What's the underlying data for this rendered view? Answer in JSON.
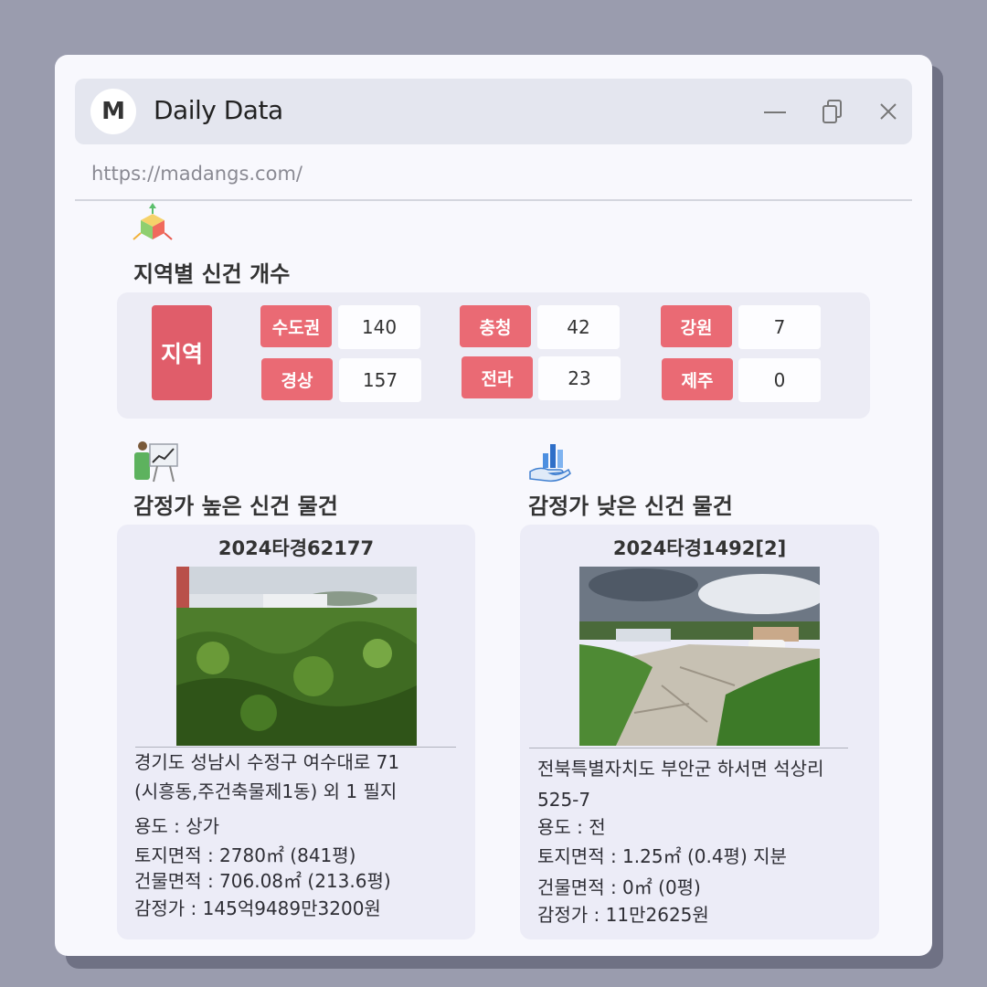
{
  "window": {
    "logo_letter": "M",
    "title": "Daily Data",
    "url": "https://madangs.com/"
  },
  "icons": {
    "region_section": "cube-axes-icon",
    "high_section": "presenter-chart-icon",
    "low_section": "hand-bar-chart-icon"
  },
  "regions": {
    "title": "지역별 신건 개수",
    "header_label": "지역",
    "items": [
      {
        "name": "수도권",
        "count": "140"
      },
      {
        "name": "경상",
        "count": "157"
      },
      {
        "name": "충청",
        "count": "42"
      },
      {
        "name": "전라",
        "count": "23"
      },
      {
        "name": "강원",
        "count": "7"
      },
      {
        "name": "제주",
        "count": "0"
      }
    ]
  },
  "high": {
    "section_title": "감정가 높은 신건 물건",
    "case_no": "2024타경62177",
    "address_line1": "경기도 성남시 수정구 여수대로 71",
    "address_line2": "(시흥동,주건축물제1동) 외 1 필지",
    "usage": "용도 : 상가",
    "land_area": "토지면적 : 2780㎡ (841평)",
    "building_area": "건물면적 : 706.08㎡ (213.6평)",
    "appraisal": "감정가 : 145억9489만3200원"
  },
  "low": {
    "section_title": "감정가 낮은 신건 물건",
    "case_no": "2024타경1492[2]",
    "address_line1": "전북특별자치도 부안군 하서면 석상리",
    "address_line2": "525-7",
    "usage": "용도 : 전",
    "land_area": "토지면적 : 1.25㎡ (0.4평) 지분",
    "building_area": "건물면적 : 0㎡ (0평)",
    "appraisal": "감정가 : 11만2625원"
  },
  "colors": {
    "accent_red": "#e05d6a",
    "label_red": "#ea6a74",
    "window_bg": "#f8f8fd",
    "panel_bg": "#ececf5"
  }
}
